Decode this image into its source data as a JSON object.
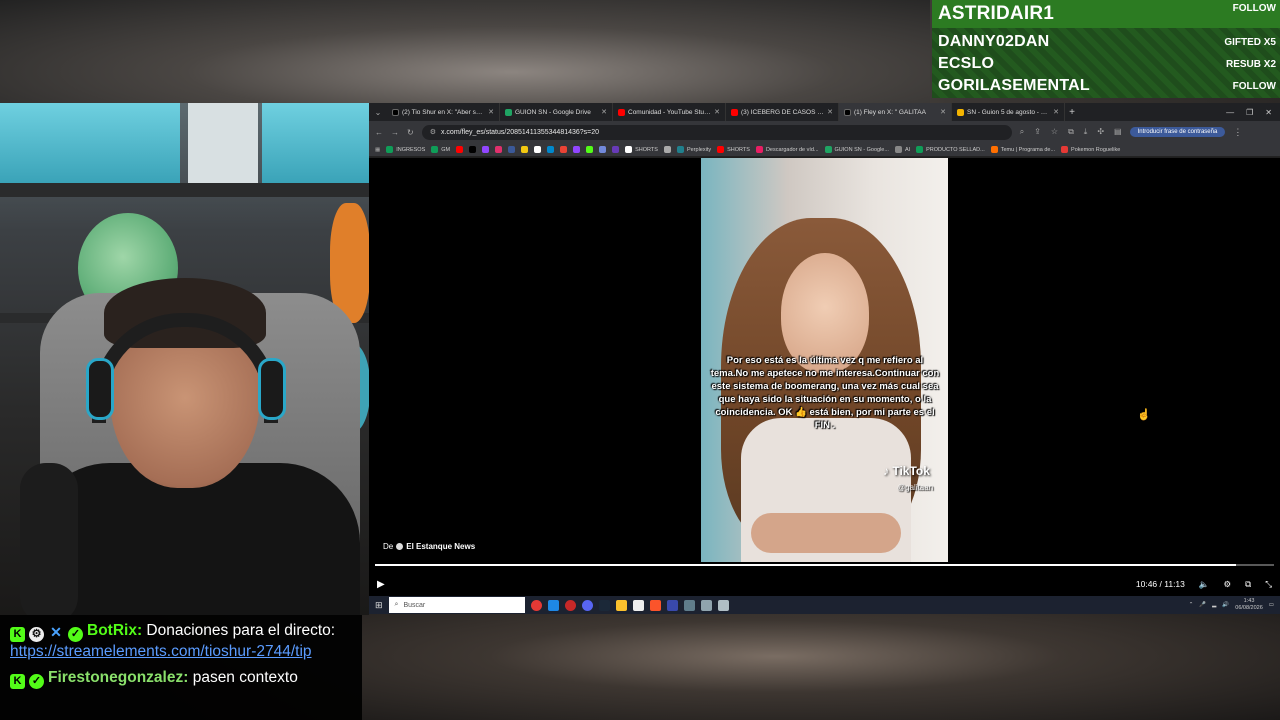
{
  "alerts": {
    "rows": [
      {
        "name": "ASTRIDAIR1",
        "tag": "FOLLOW"
      },
      {
        "name": "DANNY02DAN",
        "tag": "GIFTED X5"
      },
      {
        "name": "ECSLO",
        "tag": "RESUB X2"
      },
      {
        "name": "GORILASEMENTAL",
        "tag": "FOLLOW"
      }
    ]
  },
  "chat": {
    "messages": [
      {
        "user": "BotRix:",
        "text": " Donaciones para el directo: ",
        "link": "https://streamelements.com/tioshur-2744/tip"
      },
      {
        "user": "Firestonegonzalez:",
        "text": " pasen contexto"
      }
    ]
  },
  "browser": {
    "tabs": [
      {
        "label": "(2) Tio Shur en X: \"Aber shur m",
        "icon": "x-icon",
        "color": "#000000"
      },
      {
        "label": "GUION SN - Google Drive",
        "icon": "drive-icon",
        "color": "#1fa463"
      },
      {
        "label": "Comunidad - YouTube Studio",
        "icon": "youtube-icon",
        "color": "#ff0000"
      },
      {
        "label": "(3) ICEBERG DE CASOS OCURR",
        "icon": "youtube-icon",
        "color": "#ff0000"
      },
      {
        "label": "(1) Fley en X: \" GALITAA",
        "icon": "x-icon",
        "color": "#000000",
        "active": true
      },
      {
        "label": "SN - Guion 5 de agosto - Prese",
        "icon": "slides-icon",
        "color": "#f4b400"
      }
    ],
    "url": "x.com/fley_es/status/2085141135534481436?s=20",
    "password_button": "Introducir frase de contraseña",
    "bookmarks": [
      {
        "label": "INGRESOS",
        "color": "#0f9d58"
      },
      {
        "label": "GM",
        "color": "#0f9d58"
      },
      {
        "label": "",
        "color": "#ff0000"
      },
      {
        "label": "",
        "color": "#000000"
      },
      {
        "label": "",
        "color": "#9146ff"
      },
      {
        "label": "",
        "color": "#e1306c"
      },
      {
        "label": "",
        "color": "#3b5998"
      },
      {
        "label": "",
        "color": "#f2c811"
      },
      {
        "label": "",
        "color": "#ffffff"
      },
      {
        "label": "",
        "color": "#0088cc"
      },
      {
        "label": "",
        "color": "#ea4335"
      },
      {
        "label": "",
        "color": "#9146ff"
      },
      {
        "label": "",
        "color": "#53fc18"
      },
      {
        "label": "",
        "color": "#7289da"
      },
      {
        "label": "",
        "color": "#673ab7"
      },
      {
        "label": "SHORTS",
        "color": "#ffffff"
      },
      {
        "label": "",
        "color": "#aaaaaa"
      },
      {
        "label": "Perplexity",
        "color": "#20808d"
      },
      {
        "label": "SHORTS",
        "color": "#ff0000"
      },
      {
        "label": "Descargador de víd...",
        "color": "#e91e63"
      },
      {
        "label": "GUION SN - Google...",
        "color": "#1fa463"
      },
      {
        "label": "AI",
        "color": "#888888"
      },
      {
        "label": "PRODUCTO SELLAD...",
        "color": "#0f9d58"
      },
      {
        "label": "Temu | Programa de...",
        "color": "#ff6f00"
      },
      {
        "label": "Pokemon Roguelike",
        "color": "#e53935"
      }
    ]
  },
  "video": {
    "caption": "Por eso está es la última vez q me refiero al tema.No me apetece no me interesa.Continuar con este sistema de boomerang, una vez más cual sea que haya sido la situación en su momento, o la coincidencia. OK 👍 está bien, por mi parte es el FIN .",
    "tiktok_brand": "TikTok",
    "tiktok_handle": "@galitaan",
    "source_prefix": "De",
    "source_name": "El Estanque News",
    "time": "10:46 / 11:13",
    "progress": 0.958
  },
  "taskbar": {
    "search_placeholder": "Buscar",
    "clock_time": "1:43",
    "clock_date": "06/08/2026"
  }
}
